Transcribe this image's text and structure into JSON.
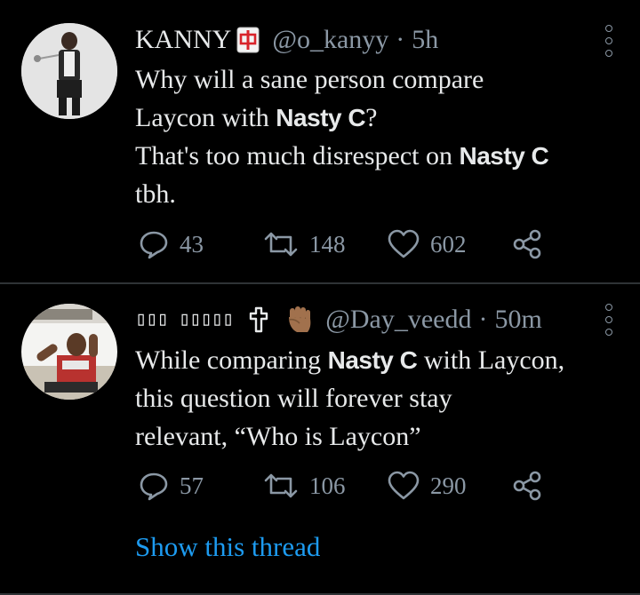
{
  "tweets": [
    {
      "name": "KANNY",
      "badge": "mahjong-red-dragon-emoji",
      "handle": "@o_kanyy",
      "separator": "·",
      "time": "5h",
      "text_lines": [
        [
          {
            "t": "Why will a sane person compare",
            "b": false
          }
        ],
        [
          {
            "t": "Laycon with ",
            "b": false
          },
          {
            "t": "Nasty C",
            "b": true
          },
          {
            "t": "?",
            "b": false
          }
        ],
        [
          {
            "t": "That's too much disrespect on ",
            "b": false
          },
          {
            "t": "Nasty C",
            "b": true
          }
        ],
        [
          {
            "t": "tbh.",
            "b": false
          }
        ]
      ],
      "replies": "43",
      "retweets": "148",
      "likes": "602"
    },
    {
      "name": "▯▯▯ ▯▯▯▯▯",
      "badge": "latin-cross-raised-fist-emoji",
      "handle": "@Day_veedd",
      "separator": "·",
      "time": "50m",
      "text_lines": [
        [
          {
            "t": "While comparing ",
            "b": false
          },
          {
            "t": "Nasty C",
            "b": true
          },
          {
            "t": " with Laycon,",
            "b": false
          }
        ],
        [
          {
            "t": "this question will forever stay",
            "b": false
          }
        ],
        [
          {
            "t": "relevant, “Who is Laycon”",
            "b": false
          }
        ]
      ],
      "replies": "57",
      "retweets": "106",
      "likes": "290",
      "show_thread": "Show this thread"
    }
  ],
  "colors": {
    "background": "#000000",
    "text": "#e7e9ea",
    "muted": "#8b98a5",
    "link": "#1d9bf0",
    "divider": "#2f3336"
  },
  "icons": {
    "reply": "reply-bubble-icon",
    "retweet": "retweet-arrows-icon",
    "like": "heart-outline-icon",
    "share": "share-nodes-icon",
    "more": "vertical-dots-icon"
  }
}
